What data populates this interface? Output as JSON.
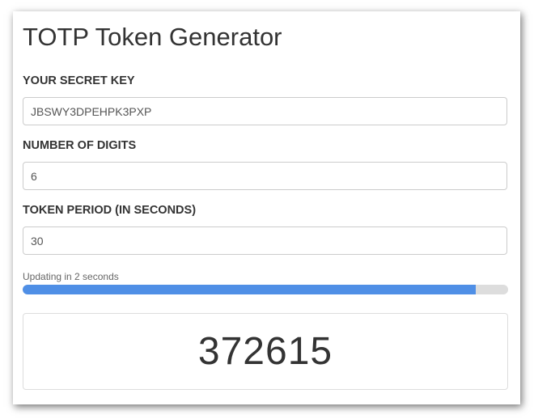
{
  "app": {
    "title": "TOTP Token Generator"
  },
  "fields": {
    "secret": {
      "label": "YOUR SECRET KEY",
      "value": "JBSWY3DPEHPK3PXP"
    },
    "digits": {
      "label": "NUMBER OF DIGITS",
      "value": "6"
    },
    "period": {
      "label": "TOKEN PERIOD (IN SECONDS)",
      "value": "30"
    }
  },
  "countdown": {
    "status_text": "Updating in 2 seconds",
    "progress_fraction": 0.933
  },
  "token": {
    "value": "372615"
  },
  "colors": {
    "progress_fill": "#4f8fe6",
    "progress_track": "#dddddd",
    "text": "#333333"
  }
}
